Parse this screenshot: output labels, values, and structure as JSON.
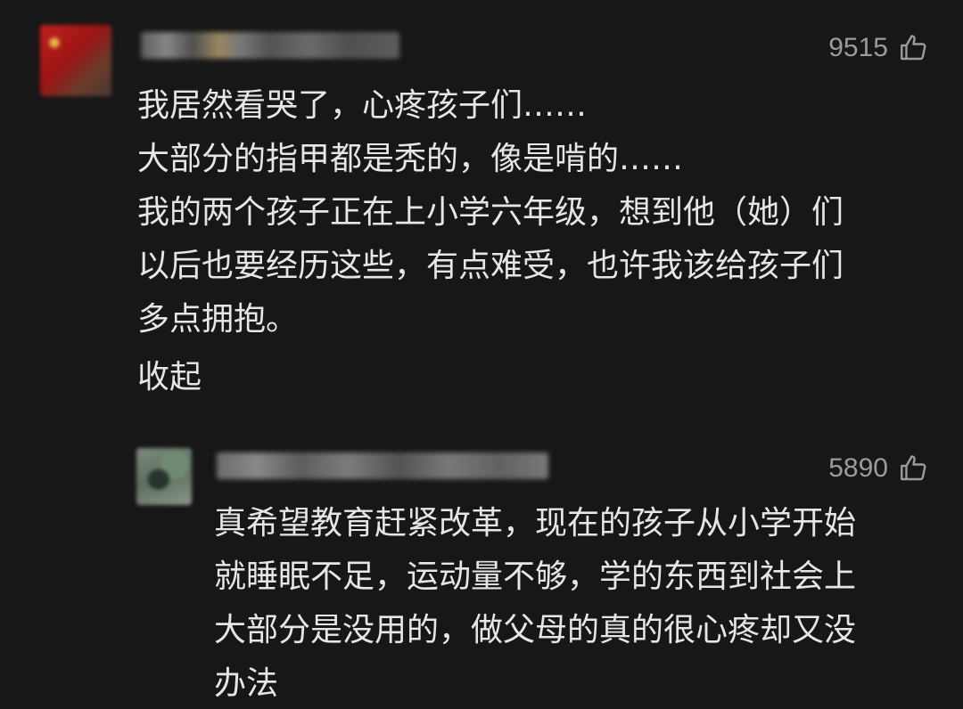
{
  "comments": [
    {
      "likes": "9515",
      "lines": [
        "我居然看哭了，心疼孩子们……",
        "大部分的指甲都是秃的，像是啃的……",
        "我的两个孩子正在上小学六年级，想到他（她）们",
        "以后也要经历这些，有点难受，也许我该给孩子们",
        "多点拥抱。"
      ],
      "collapse_label": "收起",
      "icon": "thumbs-up-icon"
    }
  ],
  "reply": {
    "likes": "5890",
    "lines": [
      "真希望教育赶紧改革，现在的孩子从小学开始",
      "就睡眠不足，运动量不够，学的东西到社会上",
      "大部分是没用的，做父母的真的很心疼却又没",
      "办法"
    ],
    "icon": "thumbs-up-icon"
  }
}
